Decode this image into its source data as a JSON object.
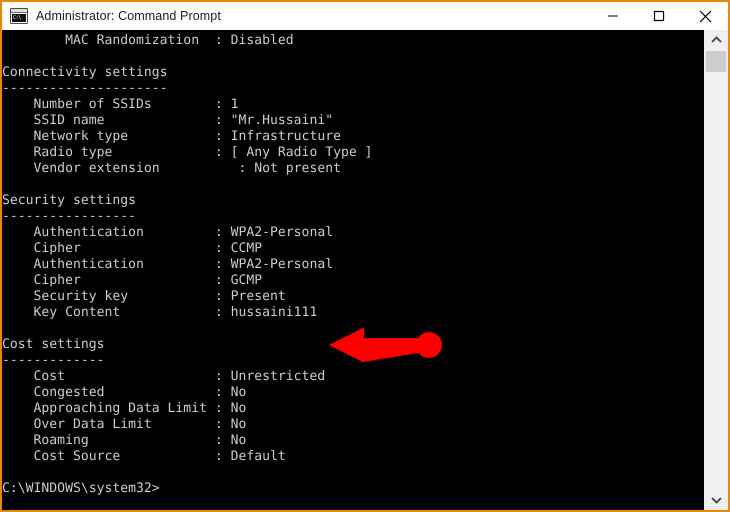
{
  "window": {
    "title": "Administrator: Command Prompt",
    "icon": "console-icon",
    "icon_glyph": "C:\\",
    "border_color": "#e8870f",
    "titlebar_background": "#ffffff",
    "console_background": "#000000",
    "console_text_color": "#cccccc"
  },
  "caption_buttons": {
    "minimize_label": "Minimize",
    "maximize_label": "Maximize",
    "close_label": "Close"
  },
  "scrollbar": {
    "up_arrow_label": "Scroll up",
    "down_arrow_label": "Scroll down",
    "thumb_label": "Scroll thumb"
  },
  "annotation": {
    "type": "arrow",
    "color": "#ff0000",
    "direction": "left",
    "points_to": "hussaini111"
  },
  "console": {
    "prompt": "C:\\WINDOWS\\system32>",
    "lines": [
      "        MAC Randomization  : Disabled",
      "",
      "Connectivity settings",
      "---------------------",
      "    Number of SSIDs        : 1",
      "    SSID name              : \"Mr.Hussaini\"",
      "    Network type           : Infrastructure",
      "    Radio type             : [ Any Radio Type ]",
      "    Vendor extension          : Not present",
      "",
      "Security settings",
      "-----------------",
      "    Authentication         : WPA2-Personal",
      "    Cipher                 : CCMP",
      "    Authentication         : WPA2-Personal",
      "    Cipher                 : GCMP",
      "    Security key           : Present",
      "    Key Content            : hussaini111",
      "",
      "Cost settings",
      "-------------",
      "    Cost                   : Unrestricted",
      "    Congested              : No",
      "    Approaching Data Limit : No",
      "    Over Data Limit        : No",
      "    Roaming                : No",
      "    Cost Source            : Default",
      "",
      "C:\\WINDOWS\\system32>"
    ],
    "sections": [
      {
        "heading": "Connectivity settings",
        "rule": "---------------------",
        "rows": [
          {
            "label": "Number of SSIDs",
            "value": "1"
          },
          {
            "label": "SSID name",
            "value": "\"Mr.Hussaini\""
          },
          {
            "label": "Network type",
            "value": "Infrastructure"
          },
          {
            "label": "Radio type",
            "value": "[ Any Radio Type ]"
          },
          {
            "label": "Vendor extension",
            "value": "Not present"
          }
        ]
      },
      {
        "heading": "Security settings",
        "rule": "-----------------",
        "rows": [
          {
            "label": "Authentication",
            "value": "WPA2-Personal"
          },
          {
            "label": "Cipher",
            "value": "CCMP"
          },
          {
            "label": "Authentication",
            "value": "WPA2-Personal"
          },
          {
            "label": "Cipher",
            "value": "GCMP"
          },
          {
            "label": "Security key",
            "value": "Present"
          },
          {
            "label": "Key Content",
            "value": "hussaini111"
          }
        ]
      },
      {
        "heading": "Cost settings",
        "rule": "-------------",
        "rows": [
          {
            "label": "Cost",
            "value": "Unrestricted"
          },
          {
            "label": "Congested",
            "value": "No"
          },
          {
            "label": "Approaching Data Limit",
            "value": "No"
          },
          {
            "label": "Over Data Limit",
            "value": "No"
          },
          {
            "label": "Roaming",
            "value": "No"
          },
          {
            "label": "Cost Source",
            "value": "Default"
          }
        ]
      }
    ],
    "top_partial_row": {
      "label": "MAC Randomization",
      "value": "Disabled"
    }
  }
}
